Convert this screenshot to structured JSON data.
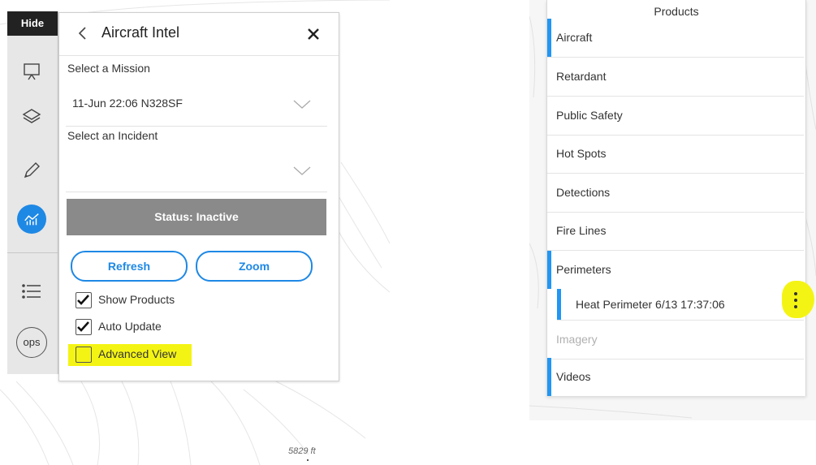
{
  "map": {
    "elevation_label": "5829 ft"
  },
  "toolbar": {
    "hide_label": "Hide",
    "ops_label": "ops",
    "active_color": "#1e88e5",
    "icons": [
      "presentation-icon",
      "layers-icon",
      "pencil-icon",
      "analytics-icon",
      "list-icon"
    ]
  },
  "aircraft_panel": {
    "title": "Aircraft Intel",
    "mission": {
      "label": "Select a Mission",
      "value": "11-Jun 22:06 N328SF"
    },
    "incident": {
      "label": "Select an Incident",
      "value": ""
    },
    "status": "Status: Inactive",
    "refresh_label": "Refresh",
    "zoom_label": "Zoom",
    "checkboxes": [
      {
        "label": "Show Products",
        "checked": true
      },
      {
        "label": "Auto Update",
        "checked": true
      },
      {
        "label": "Advanced View",
        "checked": false,
        "highlighted": true
      }
    ]
  },
  "products_panel": {
    "title": "Products",
    "items": [
      {
        "label": "Aircraft",
        "enabled": true
      },
      {
        "label": "Retardant",
        "enabled": false
      },
      {
        "label": "Public Safety",
        "enabled": false
      },
      {
        "label": "Hot Spots",
        "enabled": false
      },
      {
        "label": "Detections",
        "enabled": false
      },
      {
        "label": "Fire Lines",
        "enabled": false
      },
      {
        "label": "Perimeters",
        "enabled": true
      },
      {
        "label": "Imagery",
        "enabled": false,
        "dimmed": true
      },
      {
        "label": "Videos",
        "enabled": true
      }
    ],
    "sub_item": {
      "label": "Heat Perimeter 6/13 17:37:06",
      "menu_highlighted": true
    },
    "accent_color": "#2196f3",
    "highlight_color": "#f4f414"
  }
}
